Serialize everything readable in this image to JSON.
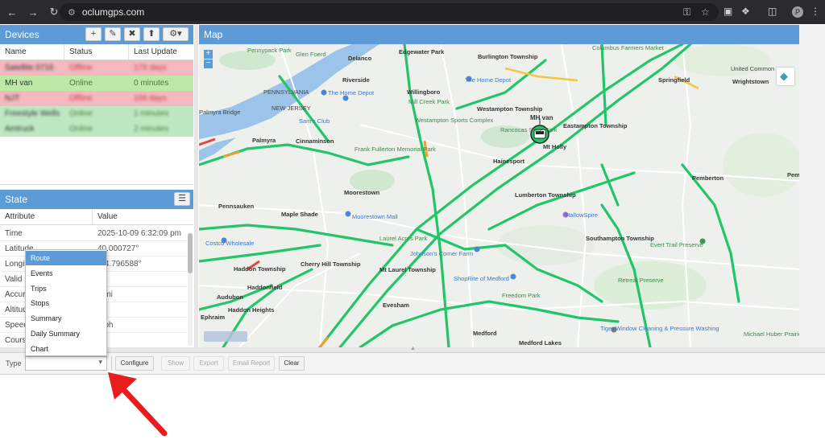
{
  "browser": {
    "url": "oclumgps.com",
    "profile_initial": "P"
  },
  "devices_panel": {
    "title": "Devices",
    "columns": [
      "Name",
      "Status",
      "Last Update"
    ],
    "rows": [
      {
        "name": "Satellite 0716",
        "status": "Offline",
        "last": "176 days",
        "color": "#f4b8bf",
        "blurred": true
      },
      {
        "name": "MH van",
        "status": "Online",
        "last": "0 minutes",
        "color": "#bde8a6",
        "blurred": false
      },
      {
        "name": "NJT",
        "status": "Offline",
        "last": "106 days",
        "color": "#f4b8bf",
        "blurred": true
      },
      {
        "name": "Freestyle Wells",
        "status": "Online",
        "last": "1 minutes",
        "color": "#bde8c2",
        "blurred": true
      },
      {
        "name": "Amtruck",
        "status": "Online",
        "last": "2 minutes",
        "color": "#bde8c2",
        "blurred": true
      }
    ]
  },
  "state_panel": {
    "title": "State",
    "columns": [
      "Attribute",
      "Value"
    ],
    "rows": [
      {
        "attr": "Time",
        "value": "2025-10-09 6:32:09 pm"
      },
      {
        "attr": "Latitude",
        "value": "40.000727°"
      },
      {
        "attr": "Longitude",
        "value": "-74.796588°"
      },
      {
        "attr": "Valid",
        "value": ""
      },
      {
        "attr": "Accuracy",
        "value": "0 mi"
      },
      {
        "attr": "Altitude",
        "value": ""
      },
      {
        "attr": "Speed",
        "value": "mph"
      },
      {
        "attr": "Course",
        "value": ""
      }
    ]
  },
  "map_panel": {
    "title": "Map",
    "vehicle_label": "MH van"
  },
  "report_type_dropdown": {
    "options": [
      "Route",
      "Events",
      "Trips",
      "Stops",
      "Summary",
      "Daily Summary",
      "Chart"
    ],
    "selected": "Route"
  },
  "report_toolbar": {
    "type_label": "Type",
    "configure": "Configure",
    "show": "Show",
    "export": "Export",
    "email_report": "Email Report",
    "clear": "Clear"
  },
  "map_labels": [
    {
      "t": "Pennypack Park",
      "c": "green"
    },
    {
      "t": "Glen Foerd",
      "c": "green"
    },
    {
      "t": "Delanco",
      "c": "b"
    },
    {
      "t": "Edgewater Park",
      "c": "b"
    },
    {
      "t": "Burlington Township",
      "c": "b"
    },
    {
      "t": "Columbus Farmers Market",
      "c": "green"
    },
    {
      "t": "Riverside",
      "c": "b"
    },
    {
      "t": "The Home Depot",
      "c": "blue"
    },
    {
      "t": "Willingboro",
      "c": "b"
    },
    {
      "t": "Mill Creek Park",
      "c": "green"
    },
    {
      "t": "The Home Depot",
      "c": "blue"
    },
    {
      "t": "Springfield",
      "c": "b"
    },
    {
      "t": "Westampton Township",
      "c": "b"
    },
    {
      "t": "United Common",
      "c": ""
    },
    {
      "t": "Wrightstown",
      "c": "b"
    },
    {
      "t": "PENNSYLVANIA",
      "c": ""
    },
    {
      "t": "NEW JERSEY",
      "c": ""
    },
    {
      "t": "Palmyra Bridge",
      "c": ""
    },
    {
      "t": "Sam's Club",
      "c": "blue"
    },
    {
      "t": "Westampton Sports Complex",
      "c": "green"
    },
    {
      "t": "Rancocas State Park",
      "c": "green"
    },
    {
      "t": "Eastampton Township",
      "c": "b"
    },
    {
      "t": "Mt Holly",
      "c": "b"
    },
    {
      "t": "Palmyra",
      "c": "b"
    },
    {
      "t": "Cinnaminson",
      "c": "b"
    },
    {
      "t": "Frank Fullerton Memorial Park",
      "c": "green"
    },
    {
      "t": "Hainesport",
      "c": "b"
    },
    {
      "t": "Pemberton",
      "c": "b"
    },
    {
      "t": "Pemberton Township",
      "c": "b"
    },
    {
      "t": "Moorestown",
      "c": "b"
    },
    {
      "t": "Lumberton Township",
      "c": "b"
    },
    {
      "t": "HallowSpire",
      "c": "blue"
    },
    {
      "t": "Pennsauken",
      "c": "b"
    },
    {
      "t": "Maple Shade",
      "c": "b"
    },
    {
      "t": "Moorestown Mall",
      "c": "blue"
    },
    {
      "t": "Laurel Acres Park",
      "c": "green"
    },
    {
      "t": "Costco Wholesale",
      "c": "blue"
    },
    {
      "t": "Southampton Township",
      "c": "b"
    },
    {
      "t": "Evert Trail Preserve",
      "c": "green"
    },
    {
      "t": "Cherry Hill Township",
      "c": "b"
    },
    {
      "t": "Mt Laurel Township",
      "c": "b"
    },
    {
      "t": "Johnson's Corner Farm",
      "c": "blue"
    },
    {
      "t": "Haddon Township",
      "c": "b"
    },
    {
      "t": "Haddonfield",
      "c": "b"
    },
    {
      "t": "ShopRite of Medford",
      "c": "blue"
    },
    {
      "t": "Retreat Preserve",
      "c": "green"
    },
    {
      "t": "Freedom Park",
      "c": "green"
    },
    {
      "t": "Audubon",
      "c": "b"
    },
    {
      "t": "Haddon Heights",
      "c": "b"
    },
    {
      "t": "Evesham",
      "c": "b"
    },
    {
      "t": "Medford",
      "c": "b"
    },
    {
      "t": "Tiger Window Cleaning & Pressure Washing",
      "c": "blue"
    },
    {
      "t": "Medford Lakes",
      "c": "b"
    },
    {
      "t": "Michael Huber Prairie Warbler",
      "c": "green"
    },
    {
      "t": "Ephraim",
      "c": "b"
    }
  ]
}
